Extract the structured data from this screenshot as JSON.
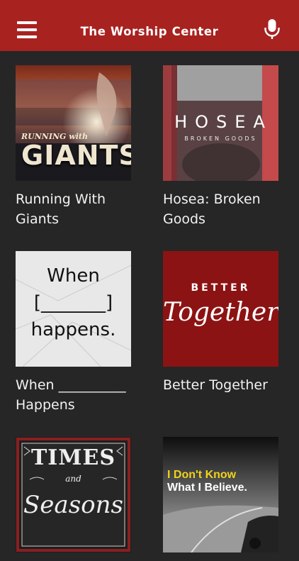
{
  "header": {
    "title": "The Worship Center",
    "menu_icon": "hamburger-menu-icon",
    "mic_icon": "microphone-icon"
  },
  "colors": {
    "header": "#a8221f",
    "background": "#262626"
  },
  "series": [
    {
      "title": "Running With Giants",
      "art_text_top": "RUNNING with",
      "art_text_main": "GIANTS"
    },
    {
      "title": "Hosea: Broken Goods",
      "art_text_main": "HOSEA",
      "art_text_sub": "BROKEN GOODS"
    },
    {
      "title": "When __________ Happens",
      "art_line1": "When",
      "art_line2": "[_______]",
      "art_line3": "happens."
    },
    {
      "title": "Better Together",
      "art_text_top": "BETTER",
      "art_text_main": "Together"
    },
    {
      "title": "",
      "art_text_top": "TIMES",
      "art_text_mid": "and",
      "art_text_main": "Seasons"
    },
    {
      "title": "",
      "art_line1": "I Don't Know",
      "art_line2": "What I Believe."
    }
  ]
}
